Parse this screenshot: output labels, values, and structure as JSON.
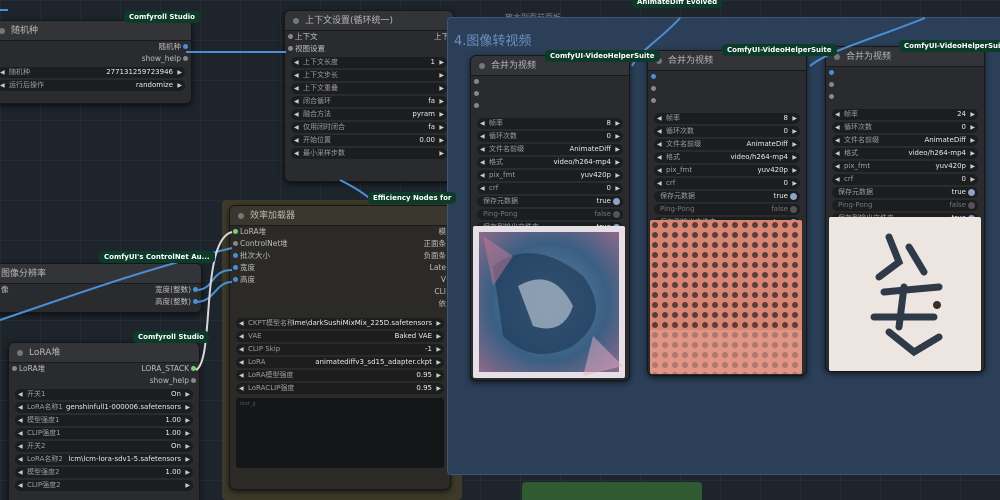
{
  "badges": {
    "studio1": "Comfyroll Studio",
    "studio2": "Comfyroll Studio",
    "controlnet": "ComfyUI's ControlNet Au...",
    "efficiency": "Efficiency Nodes for",
    "animatediff": "AnimateDiff Evolved",
    "vhs1": "ComfyUI-VideoHelperSuite",
    "vhs2": "ComfyUI-VideoHelperSuite",
    "vhs3": "ComfyUI-VideoHelperSuite"
  },
  "seed_node": {
    "title": "随机种",
    "outputs": [
      "随机种",
      "show_help"
    ],
    "widgets": [
      {
        "label": "随机种",
        "value": "277131259723946"
      },
      {
        "label": "运行后操作",
        "value": "randomize"
      }
    ]
  },
  "context_node": {
    "title": "上下文设置(循环统一)",
    "inputs": [
      "上下文",
      "视图设置"
    ],
    "out_partial": "上下",
    "widgets": [
      {
        "label": "上下文长度",
        "value": "1"
      },
      {
        "label": "上下文步长",
        "value": ""
      },
      {
        "label": "上下文重叠",
        "value": ""
      },
      {
        "label": "闭合循环",
        "value": "fa"
      },
      {
        "label": "融合方法",
        "value": "pyram"
      },
      {
        "label": "仅用闭时闭合",
        "value": "fa"
      },
      {
        "label": "开始位置",
        "value": "0.00"
      },
      {
        "label": "最小采样步数",
        "value": ""
      }
    ]
  },
  "bg_text": "放大到面前面板",
  "upscale_node": {
    "title": "图像分辨率",
    "partial_left": "像",
    "outputs": [
      "宽度(整数)",
      "高度(整数)"
    ]
  },
  "lora_node": {
    "title": "LoRA堆",
    "input": "LoRA堆",
    "outputs": [
      "LORA_STACK",
      "show_help"
    ],
    "widgets": [
      {
        "label": "开关1",
        "value": "On"
      },
      {
        "label": "LoRA名称1",
        "value": "genshinfull1-000006.safetensors"
      },
      {
        "label": "模型强度1",
        "value": "1.00"
      },
      {
        "label": "CLIP强度1",
        "value": "1.00"
      },
      {
        "label": "开关2",
        "value": "On"
      },
      {
        "label": "LoRA名称2",
        "value": "lcm\\lcm-lora-sdv1-5.safetensors"
      },
      {
        "label": "模型强度2",
        "value": "1.00"
      },
      {
        "label": "CLIP强度2",
        "value": ""
      }
    ]
  },
  "efficiency_node": {
    "title": "效率加载器",
    "inputs": [
      "LoRA堆",
      "ControlNet堆",
      "批次大小",
      "宽度",
      "高度"
    ],
    "outputs_partial": [
      "模",
      "正面条",
      "负面条",
      "Late",
      "V",
      "CLI",
      "依"
    ],
    "widgets": [
      {
        "label": "CKPT模型名称",
        "value": "ime\\darkSushiMixMix_225D.safetensors"
      },
      {
        "label": "VAE",
        "value": "Baked VAE"
      },
      {
        "label": "CLIP Skip",
        "value": "-1"
      },
      {
        "label": "LoRA",
        "value": "animatediffv3_sd15_adapter.ckpt"
      },
      {
        "label": "LoRA模型强度",
        "value": "0.95"
      },
      {
        "label": "LoRACLIP强度",
        "value": "0.95"
      }
    ],
    "textarea_placeholder": "text_g"
  },
  "video_group": {
    "title": "4.图像转视频",
    "nodes": [
      {
        "title": "合并为视频",
        "widgets": [
          {
            "label": "帧率",
            "value": "8"
          },
          {
            "label": "循环次数",
            "value": "0"
          },
          {
            "label": "文件名前缀",
            "value": "AnimateDiff"
          },
          {
            "label": "格式",
            "value": "video/h264-mp4"
          },
          {
            "label": "pix_fmt",
            "value": "yuv420p"
          },
          {
            "label": "crf",
            "value": "0"
          },
          {
            "label": "保存元数据",
            "value": "true"
          },
          {
            "label": "Ping-Pong",
            "value": "false"
          },
          {
            "label": "保存到输出文件夹",
            "value": "true"
          }
        ]
      },
      {
        "title": "合并为视频",
        "widgets": [
          {
            "label": "帧率",
            "value": "8"
          },
          {
            "label": "循环次数",
            "value": "0"
          },
          {
            "label": "文件名前缀",
            "value": "AnimateDiff"
          },
          {
            "label": "格式",
            "value": "video/h264-mp4"
          },
          {
            "label": "pix_fmt",
            "value": "yuv420p"
          },
          {
            "label": "crf",
            "value": "0"
          },
          {
            "label": "保存元数据",
            "value": "true"
          },
          {
            "label": "Ping-Pong",
            "value": "false"
          },
          {
            "label": "保存到输出文件夹",
            "value": "true"
          }
        ]
      },
      {
        "title": "合并为视频",
        "widgets": [
          {
            "label": "帧率",
            "value": "24"
          },
          {
            "label": "循环次数",
            "value": "0"
          },
          {
            "label": "文件名前缀",
            "value": "AnimateDiff"
          },
          {
            "label": "格式",
            "value": "video/h264-mp4"
          },
          {
            "label": "pix_fmt",
            "value": "yuv420p"
          },
          {
            "label": "crf",
            "value": "0"
          },
          {
            "label": "保存元数据",
            "value": "true"
          },
          {
            "label": "Ping-Pong",
            "value": "false"
          },
          {
            "label": "保存到输出文件夹",
            "value": "true"
          }
        ]
      }
    ]
  },
  "colors": {
    "link_blue": "#4a8fd6",
    "link_white": "#d8d8d8",
    "efficiency_group": "#3e3a2a",
    "video_group": "#2b3f58",
    "video_group_title": "#6c8fbf"
  }
}
